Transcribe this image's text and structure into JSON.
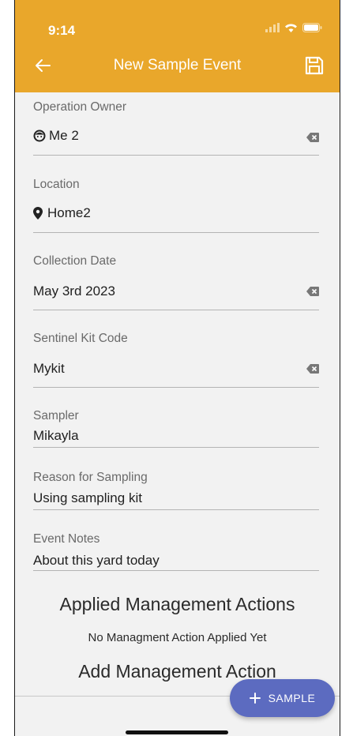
{
  "status_bar": {
    "time": "9:14"
  },
  "toolbar": {
    "title": "New Sample Event"
  },
  "fields": {
    "operation_owner": {
      "label": "Operation Owner",
      "value": "Me 2"
    },
    "location": {
      "label": "Location",
      "value": "Home2"
    },
    "collection_date": {
      "label": "Collection Date",
      "value": "May 3rd 2023"
    },
    "kit_code": {
      "label": "Sentinel Kit Code",
      "value": "Mykit"
    },
    "sampler": {
      "label": "Sampler",
      "value": "Mikayla"
    },
    "reason": {
      "label": "Reason for Sampling",
      "value": "Using sampling kit"
    },
    "notes": {
      "label": "Event Notes",
      "value": "About this yard today"
    }
  },
  "management": {
    "title": "Applied Management Actions",
    "empty_text": "No Managment Action Applied Yet",
    "add_label": "Add Management Action"
  },
  "fab": {
    "label": "SAMPLE"
  },
  "colors": {
    "header": "#e9a72b",
    "fab": "#5c6bc0",
    "background": "#f2f2f2"
  },
  "icons": [
    "back-arrow-icon",
    "save-icon",
    "face-icon",
    "location-pin-icon",
    "clear-icon",
    "plus-icon",
    "signal-icon",
    "wifi-icon",
    "battery-icon"
  ]
}
